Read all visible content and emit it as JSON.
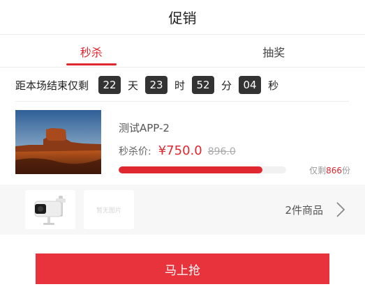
{
  "header": {
    "title": "促销"
  },
  "tabs": [
    {
      "label": "秒杀",
      "active": true
    },
    {
      "label": "抽奖",
      "active": false
    }
  ],
  "countdown": {
    "label": "距本场结束仅剩",
    "days": "22",
    "days_unit": "天",
    "hours": "23",
    "hours_unit": "时",
    "minutes": "52",
    "minutes_unit": "分",
    "seconds": "04",
    "seconds_unit": "秒"
  },
  "product": {
    "name": "测试APP-2",
    "price_label": "秒杀价:",
    "price": "¥750.0",
    "original_price": "896.0",
    "progress": 0.86,
    "stock_prefix": "仅剩",
    "stock_count": "866",
    "stock_suffix": "份"
  },
  "bundle": {
    "count_text": "2件商品",
    "placeholder_text": "暂无图片"
  },
  "buy_button": {
    "label": "马上抢"
  },
  "colors": {
    "accent": "#e0262f",
    "timer_bg": "#333333"
  }
}
